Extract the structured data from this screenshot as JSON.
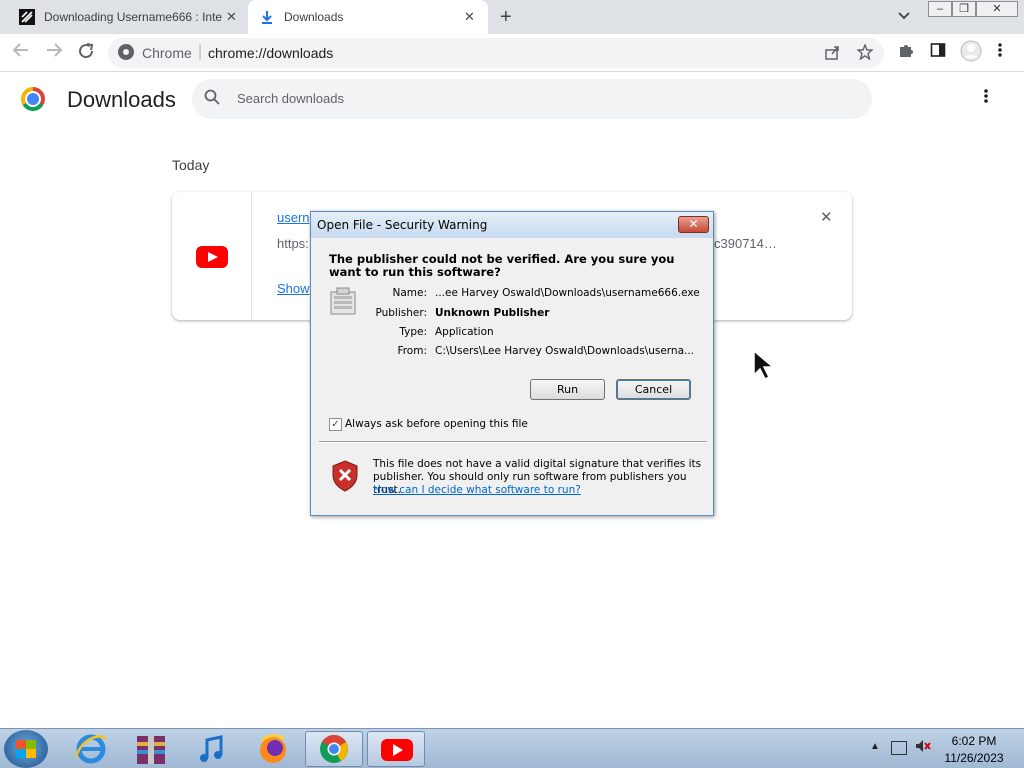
{
  "window": {
    "tabs": [
      {
        "title": "Downloading Username666 : Inte",
        "icon": "document-lines-icon"
      },
      {
        "title": "Downloads",
        "icon": "download-arrow-icon"
      }
    ],
    "new_tab_symbol": "+",
    "tab_search_symbol": "⌄",
    "close_symbol": "✕"
  },
  "toolbar": {
    "site_label": "Chrome",
    "url": "chrome://downloads",
    "separator": "|"
  },
  "downloads": {
    "title": "Downloads",
    "search_placeholder": "Search downloads",
    "section": "Today",
    "item": {
      "name": "usern",
      "url_start": "https:",
      "url_tail": "c390714…",
      "show_link": "Show",
      "source_icon": "youtube-icon"
    }
  },
  "dialog": {
    "title": "Open File - Security Warning",
    "close_symbol": "✕",
    "question": "The publisher could not be verified.  Are you sure you want to run this software?",
    "fields": [
      {
        "label": "Name:",
        "value": "...ee Harvey Oswald\\Downloads\\username666.exe",
        "bold": false
      },
      {
        "label": "Publisher:",
        "value": "Unknown Publisher",
        "bold": true
      },
      {
        "label": "Type:",
        "value": "Application",
        "bold": false
      },
      {
        "label": "From:",
        "value": "C:\\Users\\Lee Harvey Oswald\\Downloads\\userna...",
        "bold": false
      }
    ],
    "run_label": "Run",
    "cancel_label": "Cancel",
    "checkbox_label": "Always ask before opening this file",
    "checkbox_checked": true,
    "check_mark": "✓",
    "warning_text": "This file does not have a valid digital signature that verifies its publisher.  You should only run software from publishers you trust.",
    "help_link": "How can I decide what software to run?"
  },
  "taskbar": {
    "apps": [
      "internet-explorer-icon",
      "winrar-icon",
      "itunes-icon",
      "firefox-icon",
      "chrome-icon",
      "youtube-icon"
    ],
    "time": "6:02 PM",
    "date": "11/26/2023"
  },
  "colors": {
    "link": "#1a73e8",
    "youtube_red": "#ff0000",
    "dialog_bg": "#f0f0f0"
  }
}
